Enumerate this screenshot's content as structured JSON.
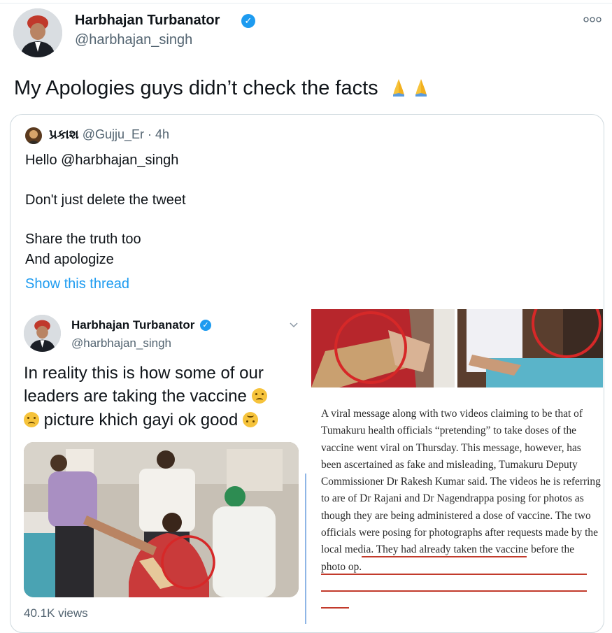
{
  "tweet": {
    "author_name": "Harbhajan Turbanator",
    "author_handle": "@harbhajan_singh",
    "text": "My Apologies guys didn’t check the facts",
    "emoji": "🙏🙏"
  },
  "quoted_tweet": {
    "author_name": "પ્રકાશ",
    "author_handle": "@Gujju_Er",
    "time": "· 4h",
    "lines": [
      "Hello @harbhajan_singh",
      "Don't just delete the tweet",
      "Share the truth too",
      "And apologize"
    ],
    "show_thread": "Show this thread"
  },
  "inner_tweet": {
    "author_name": "Harbhajan Turbanator",
    "author_handle": "@harbhajan_singh",
    "text_lines": [
      "In reality this is how some of our",
      "leaders are taking the vaccine",
      "picture khich gayi ok good"
    ],
    "views": "40.1K views"
  },
  "article": {
    "text": "A viral message along with two videos claiming to be that of Tumakuru health officials “pretending” to take doses of the vaccine went viral on Thursday. This message, however, has been ascertained as fake and misleading, Tumakuru Deputy Commissioner Dr Rakesh Kumar said. The videos he is referring to are of Dr Rajani and Dr Nagendrappa posing for photos as though they are being administered a dose of vaccine. The two officials were posing for photographs after requests made by the local media. They had already taken the vaccine before the photo op."
  },
  "colors": {
    "accent": "#1d9bf0",
    "text": "#0f1419",
    "muted": "#536471",
    "border": "#cfd9de",
    "highlight_circle": "#d62828"
  },
  "icons": [
    "verified-badge-icon",
    "more-options-icon",
    "chevron-down-icon",
    "folded-hands-emoji",
    "confused-face-emoji",
    "upside-down-face-emoji"
  ]
}
